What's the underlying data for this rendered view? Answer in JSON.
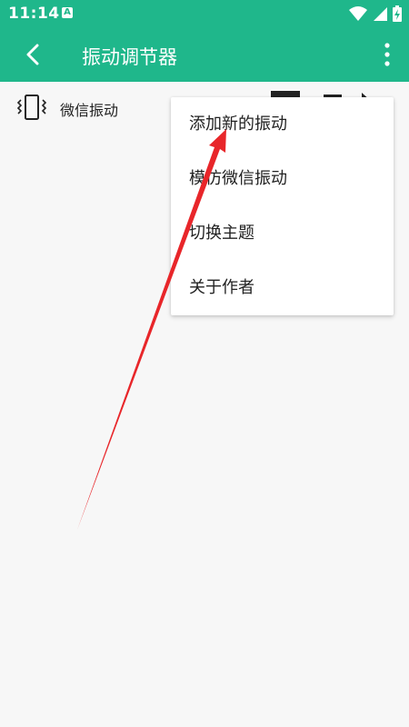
{
  "status_bar": {
    "time": "11:14",
    "notification_icon": "A",
    "icons": [
      "wifi-icon",
      "signal-icon",
      "battery-icon"
    ]
  },
  "app_bar": {
    "title": "振动调节器",
    "back_icon": "chevron-left-icon",
    "more_icon": "more-vertical-icon"
  },
  "list": {
    "items": [
      {
        "label": "微信振动",
        "icon": "vibration-icon"
      }
    ]
  },
  "menu": {
    "items": [
      {
        "label": "添加新的振动"
      },
      {
        "label": "模仿微信振动"
      },
      {
        "label": "切换主题"
      },
      {
        "label": "关于作者"
      }
    ]
  },
  "colors": {
    "primary": "#1fb78b",
    "background": "#f7f7f7",
    "menu_bg": "#ffffff",
    "annotation_arrow": "#e8262a"
  }
}
